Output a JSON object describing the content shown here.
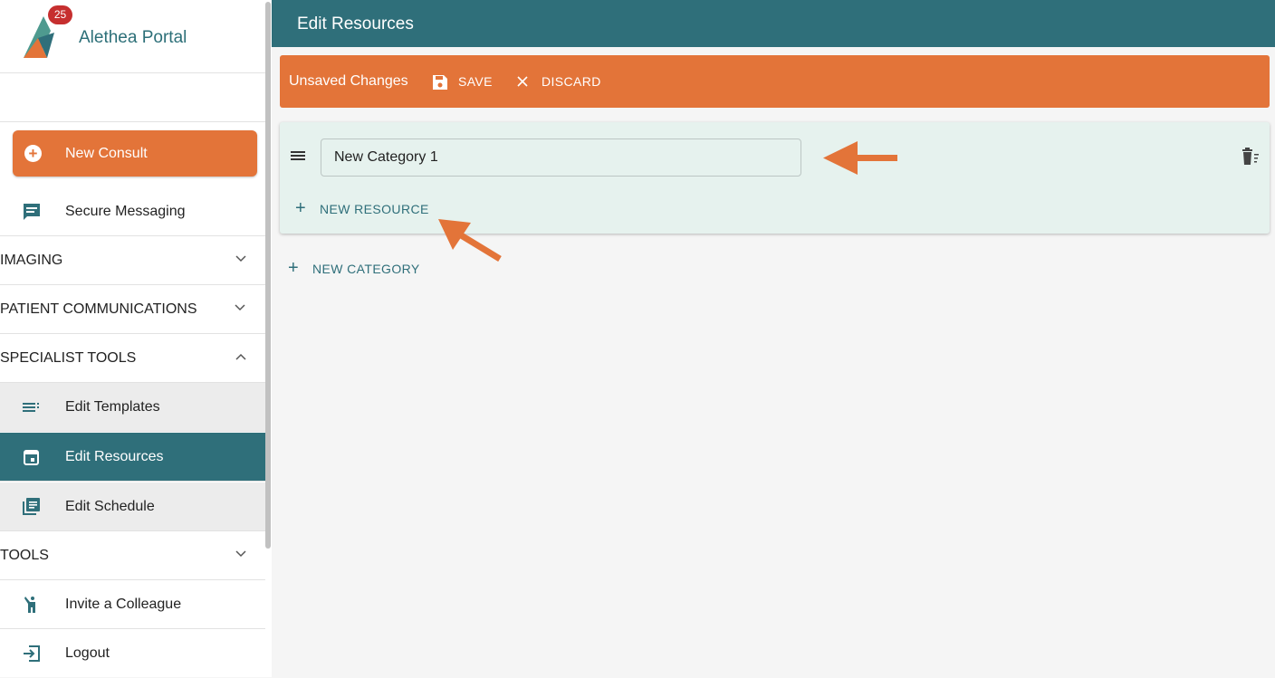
{
  "app": {
    "name": "Alethea Portal",
    "notification_count": "25"
  },
  "sidebar": {
    "new_consult": "New Consult",
    "secure_messaging": "Secure Messaging",
    "sections": {
      "imaging": "IMAGING",
      "patient_communications": "PATIENT COMMUNICATIONS",
      "specialist_tools": "SPECIALIST TOOLS",
      "tools": "TOOLS"
    },
    "specialist_items": {
      "edit_templates": "Edit Templates",
      "edit_resources": "Edit Resources",
      "edit_schedule": "Edit Schedule"
    },
    "invite": "Invite a Colleague",
    "logout": "Logout",
    "active_item": "Edit Resources"
  },
  "header": {
    "title": "Edit Resources"
  },
  "unsaved_bar": {
    "text": "Unsaved Changes",
    "save_label": "SAVE",
    "discard_label": "DISCARD"
  },
  "category": {
    "name_value": "New Category 1",
    "new_resource_label": "NEW RESOURCE"
  },
  "new_category_label": "NEW CATEGORY",
  "colors": {
    "teal": "#2f6f7a",
    "orange": "#e37439",
    "card_bg": "#e6f2ee",
    "badge_red": "#c62f2f"
  },
  "icons": {
    "logo": "alethea-logo-icon",
    "new_consult": "plus-circle-icon",
    "secure_messaging": "chat-bubble-icon",
    "edit_templates": "list-icon",
    "edit_resources": "calendar-icon",
    "edit_schedule": "library-books-icon",
    "invite": "person-raising-hand-icon",
    "logout": "logout-icon",
    "save": "floppy-disk-icon",
    "discard": "close-icon",
    "drag": "drag-handle-icon",
    "delete": "delete-sweep-icon"
  }
}
